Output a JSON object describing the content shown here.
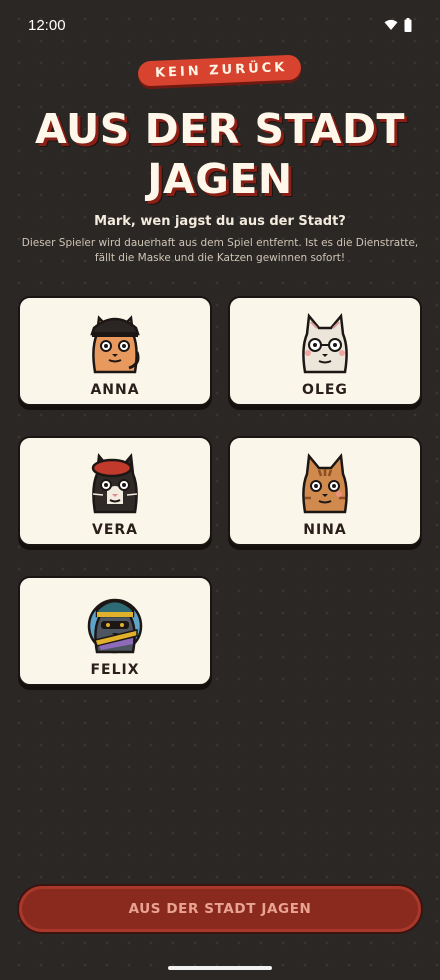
{
  "status_bar": {
    "time": "12:00"
  },
  "badge": {
    "label": "KEIN ZURÜCK"
  },
  "title": {
    "line1": "AUS DER STADT",
    "line2": "JAGEN"
  },
  "question": "Mark, wen jagst du aus der Stadt?",
  "description": "Dieser Spieler wird dauerhaft aus dem Spiel entfernt. Ist es die Dienstratte, fällt die Maske und die Katzen gewinnen sofort!",
  "players": [
    {
      "name": "ANNA",
      "avatar_icon": "cat-black-cap-icon",
      "fur": "#e89a5e",
      "hat": "#2b2623"
    },
    {
      "name": "OLEG",
      "avatar_icon": "cat-white-glasses-icon",
      "fur": "#ece6da",
      "hat": ""
    },
    {
      "name": "VERA",
      "avatar_icon": "cat-black-beret-icon",
      "fur": "#2f2a28",
      "hat": "#c23a2b"
    },
    {
      "name": "NINA",
      "avatar_icon": "cat-tabby-icon",
      "fur": "#d08a4e",
      "hat": ""
    },
    {
      "name": "FELIX",
      "avatar_icon": "cat-grey-beanie-icon",
      "fur": "#4d5560",
      "hat": "#2f6b74"
    }
  ],
  "action_button": {
    "label": "AUS DER STADT JAGEN"
  },
  "colors": {
    "accent": "#d7432e",
    "button": "#8a2a1e",
    "card": "#fbf6ea",
    "background": "#2b2724"
  }
}
